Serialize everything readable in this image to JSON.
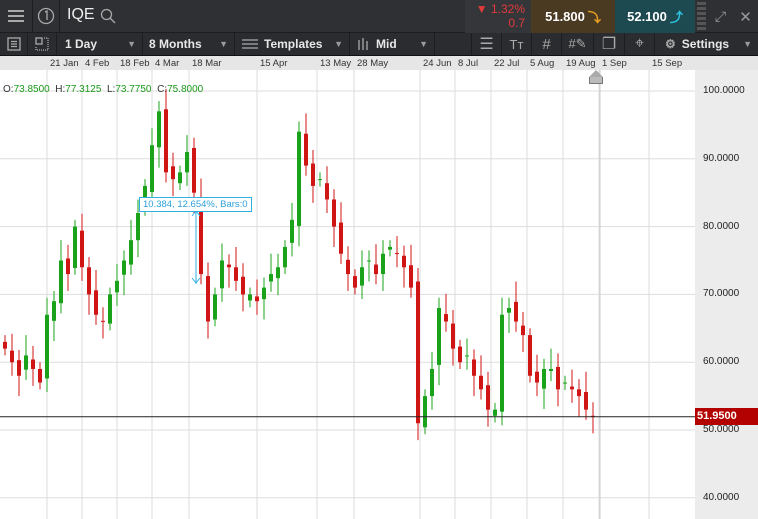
{
  "header": {
    "symbol": "IQE",
    "change_pct": "1.32%",
    "change_abs": "0.7",
    "sell": "51.800",
    "buy": "52.100",
    "colors": {
      "down": "#e23b3b",
      "sell_bg": "#4a3a22",
      "buy_bg": "#1d4a50"
    }
  },
  "toolbar": {
    "interval": "1 Day",
    "range": "8 Months",
    "templates": "Templates",
    "price_type": "Mid",
    "settings": "Settings"
  },
  "date_axis": [
    "21 Jan",
    "4 Feb",
    "18 Feb",
    "4 Mar",
    "18 Mar",
    "15 Apr",
    "13 May",
    "28 May",
    "24 Jun",
    "8 Jul",
    "22 Jul",
    "5 Aug",
    "19 Aug",
    "1 Sep",
    "15 Sep"
  ],
  "ohlc": {
    "o_label": "O:",
    "o": "73.8500",
    "h_label": "H:",
    "h": "77.3125",
    "l_label": "L:",
    "l": "73.7750",
    "c_label": "C:",
    "c": "75.8000"
  },
  "measure": {
    "label": "10.384, 12.654%, Bars:0"
  },
  "price_axis": [
    "100.0000",
    "90.0000",
    "80.0000",
    "70.0000",
    "60.0000",
    "50.0000",
    "40.0000"
  ],
  "last_price": "51.9500",
  "chart_data": {
    "type": "candlestick",
    "ylim": [
      37,
      103
    ],
    "colors": {
      "up": "#1aa31a",
      "down": "#d01515",
      "last": "#b30000"
    },
    "closes": [
      62,
      60,
      58,
      61,
      59,
      57,
      67,
      69,
      75,
      73,
      80,
      74,
      70,
      67,
      66,
      70,
      72,
      75,
      78,
      82,
      86,
      92,
      97,
      88,
      87,
      88,
      91,
      85,
      73,
      66,
      70,
      75,
      74,
      72,
      70,
      70,
      69,
      71,
      73,
      74,
      77,
      81,
      94,
      89,
      86,
      87,
      84,
      80,
      76,
      73,
      71,
      74,
      75,
      73,
      76,
      77,
      76,
      74,
      71,
      51,
      55,
      59,
      68,
      66,
      62,
      60,
      61,
      58,
      56,
      53,
      53,
      67,
      68,
      66,
      64,
      58,
      57,
      59,
      59,
      56,
      57,
      56,
      55,
      53,
      52
    ]
  }
}
